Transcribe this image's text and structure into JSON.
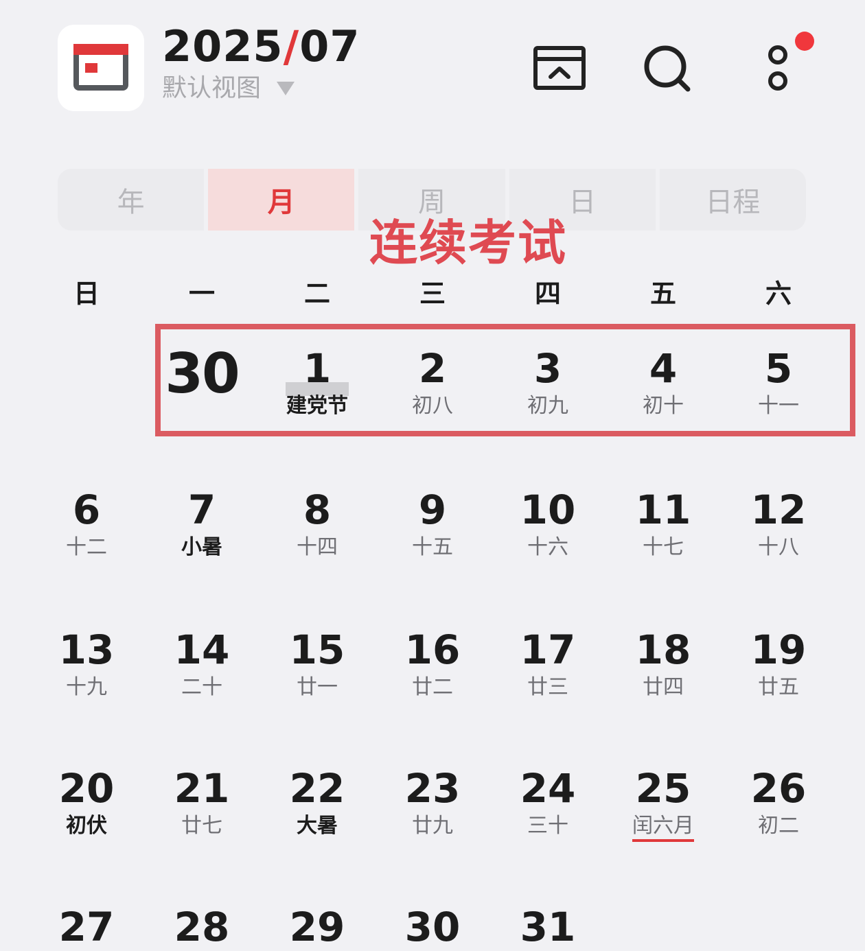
{
  "header": {
    "year": "2025",
    "separator": "/",
    "month": "07",
    "view_label": "默认视图"
  },
  "icons": {
    "app": "calendar-app-icon",
    "inbox": "inbox-icon",
    "search": "search-icon",
    "more": "more-icon",
    "badge_color": "#f0373c"
  },
  "tabs": [
    {
      "label": "年",
      "active": false
    },
    {
      "label": "月",
      "active": true
    },
    {
      "label": "周",
      "active": false
    },
    {
      "label": "日",
      "active": false
    },
    {
      "label": "日程",
      "active": false
    }
  ],
  "annotation": "连续考试",
  "weekdays": [
    "日",
    "一",
    "二",
    "三",
    "四",
    "五",
    "六"
  ],
  "weeks": [
    [
      null,
      {
        "num": "30",
        "lunar": ""
      },
      {
        "num": "1",
        "lunar": "建党节",
        "style": "bold"
      },
      {
        "num": "2",
        "lunar": "初八"
      },
      {
        "num": "3",
        "lunar": "初九"
      },
      {
        "num": "4",
        "lunar": "初十"
      },
      {
        "num": "5",
        "lunar": "十一"
      }
    ],
    [
      {
        "num": "6",
        "lunar": "十二"
      },
      {
        "num": "7",
        "lunar": "小暑",
        "style": "bold"
      },
      {
        "num": "8",
        "lunar": "十四"
      },
      {
        "num": "9",
        "lunar": "十五"
      },
      {
        "num": "10",
        "lunar": "十六"
      },
      {
        "num": "11",
        "lunar": "十七"
      },
      {
        "num": "12",
        "lunar": "十八"
      }
    ],
    [
      {
        "num": "13",
        "lunar": "十九"
      },
      {
        "num": "14",
        "lunar": "二十"
      },
      {
        "num": "15",
        "lunar": "廿一"
      },
      {
        "num": "16",
        "lunar": "廿二"
      },
      {
        "num": "17",
        "lunar": "廿三"
      },
      {
        "num": "18",
        "lunar": "廿四"
      },
      {
        "num": "19",
        "lunar": "廿五"
      }
    ],
    [
      {
        "num": "20",
        "lunar": "初伏",
        "style": "bold"
      },
      {
        "num": "21",
        "lunar": "廿七"
      },
      {
        "num": "22",
        "lunar": "大暑",
        "style": "bold"
      },
      {
        "num": "23",
        "lunar": "廿九"
      },
      {
        "num": "24",
        "lunar": "三十"
      },
      {
        "num": "25",
        "lunar": "闰六月",
        "style": "underline"
      },
      {
        "num": "26",
        "lunar": "初二"
      }
    ],
    [
      {
        "num": "27",
        "lunar": ""
      },
      {
        "num": "28",
        "lunar": ""
      },
      {
        "num": "29",
        "lunar": ""
      },
      {
        "num": "30",
        "lunar": ""
      },
      {
        "num": "31",
        "lunar": ""
      },
      null,
      null
    ]
  ]
}
